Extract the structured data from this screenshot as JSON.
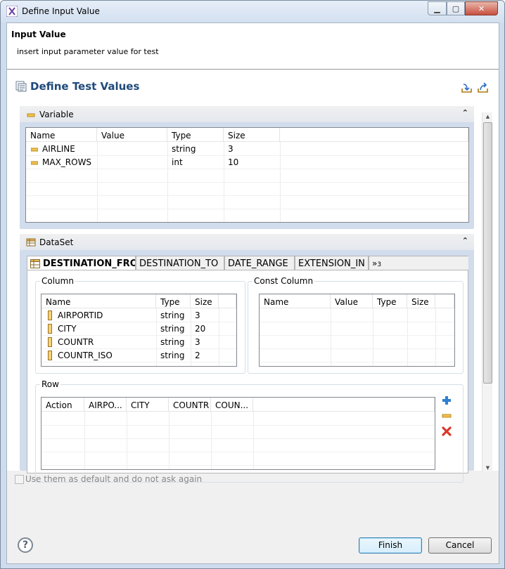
{
  "window": {
    "title": "Define Input Value"
  },
  "header": {
    "title": "Input Value",
    "description": "insert input parameter value for test"
  },
  "form": {
    "title": "Define Test Values"
  },
  "variable": {
    "title": "Variable",
    "columns": [
      "Name",
      "Value",
      "Type",
      "Size"
    ],
    "rows": [
      {
        "name": "AIRLINE",
        "value": "",
        "type": "string",
        "size": "3"
      },
      {
        "name": "MAX_ROWS",
        "value": "",
        "type": "int",
        "size": "10"
      }
    ]
  },
  "dataset": {
    "title": "DataSet",
    "tabs": [
      "DESTINATION_FROM",
      "DESTINATION_TO",
      "DATE_RANGE",
      "EXTENSION_IN"
    ],
    "more_tabs": "»",
    "more_count": "3",
    "column_group": "Column",
    "column_headers": [
      "Name",
      "Type",
      "Size"
    ],
    "column_rows": [
      {
        "name": "AIRPORTID",
        "type": "string",
        "size": "3"
      },
      {
        "name": "CITY",
        "type": "string",
        "size": "20"
      },
      {
        "name": "COUNTR",
        "type": "string",
        "size": "3"
      },
      {
        "name": "COUNTR_ISO",
        "type": "string",
        "size": "2"
      }
    ],
    "const_group": "Const Column",
    "const_headers": [
      "Name",
      "Value",
      "Type",
      "Size"
    ],
    "row_group": "Row",
    "row_headers": [
      "Action",
      "AIRPO...",
      "CITY",
      "COUNTR",
      "COUN..."
    ]
  },
  "checkbox": {
    "label": "Use them as default and do not ask again"
  },
  "buttons": {
    "help": "?",
    "finish": "Finish",
    "cancel": "Cancel"
  },
  "colors": {
    "title_blue": "#1f4a7a",
    "section_blue": "#d1dcec",
    "add": "#2f7fd3",
    "remove": "#e6b81e",
    "delete": "#d93a2b"
  }
}
